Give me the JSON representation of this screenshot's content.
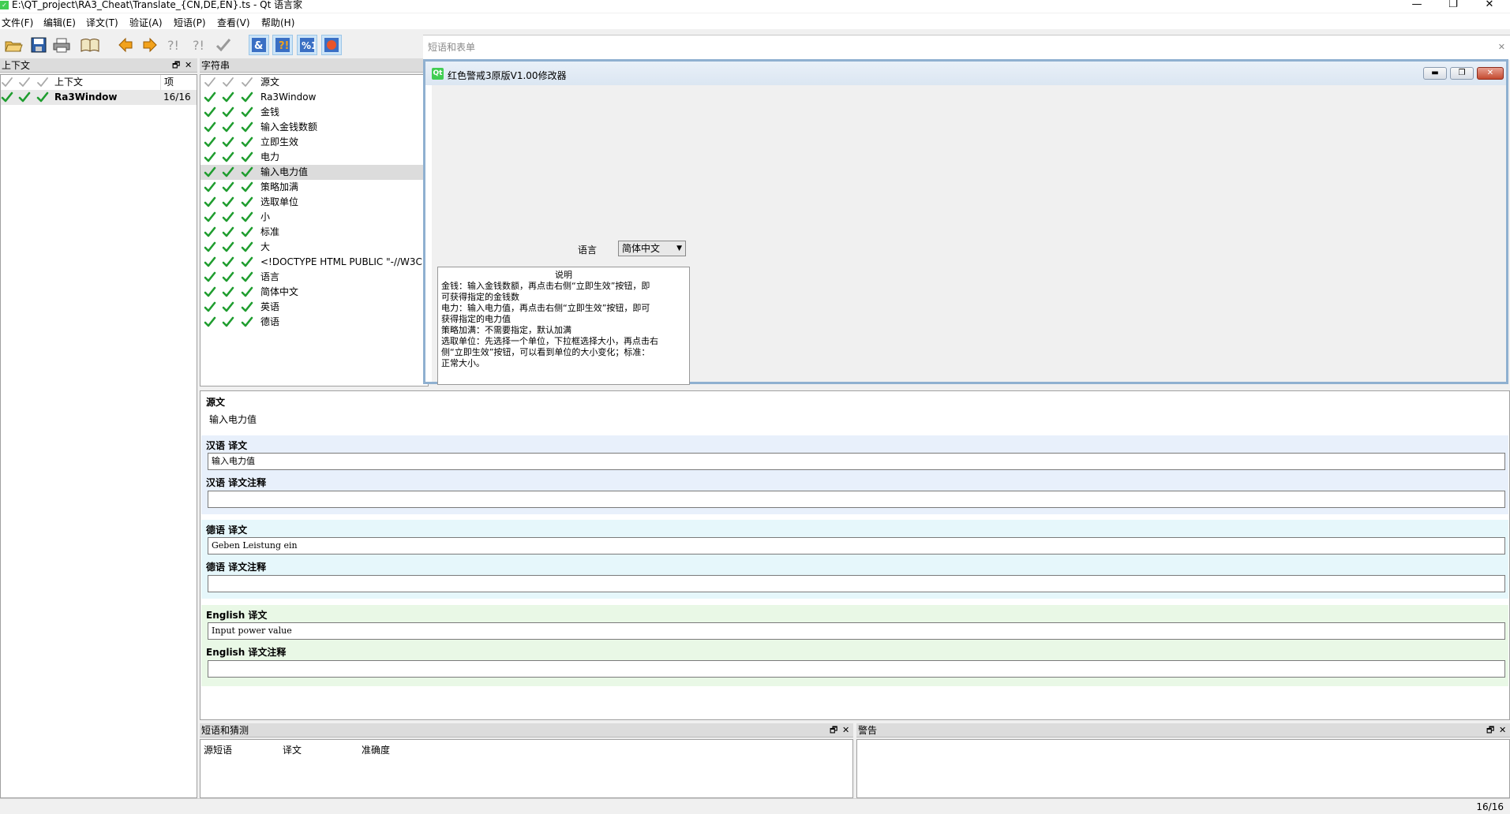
{
  "window": {
    "title": "E:\\QT_project\\RA3_Cheat\\Translate_{CN,DE,EN}.ts - Qt 语言家",
    "minimize": "—",
    "maximize": "❐",
    "close": "✕"
  },
  "menu": [
    "文件(F)",
    "编辑(E)",
    "译文(T)",
    "验证(A)",
    "短语(P)",
    "查看(V)",
    "帮助(H)"
  ],
  "toolbar_icons": [
    "open-icon",
    "save-icon",
    "print-icon",
    "phrasebook-icon",
    "previous-icon",
    "next-icon",
    "prev-unfinished-icon",
    "next-unfinished-icon",
    "done-and-next-icon",
    "accelerators-icon",
    "punctuation-icon",
    "phrase-matches-icon",
    "placemarker-icon"
  ],
  "context_pane": {
    "title": "上下文",
    "col_context": "上下文",
    "col_items": "项",
    "rows": [
      {
        "name": "Ra3Window",
        "count": "16/16"
      }
    ]
  },
  "strings_pane": {
    "title": "字符串",
    "col_source": "源文",
    "rows": [
      "Ra3Window",
      "金钱",
      "输入金钱数额",
      "立即生效",
      "电力",
      "输入电力值",
      "策略加满",
      "选取单位",
      "小",
      "标准",
      "大",
      "<!DOCTYPE HTML PUBLIC \"-//W3C",
      "语言",
      "简体中文",
      "英语",
      "德语"
    ],
    "selected_index": 5
  },
  "phrase_window": {
    "title": "短语和表单"
  },
  "preview": {
    "title": "红色警戒3原版V1.00修改器",
    "qt_logo": "Qt",
    "language_label": "语言",
    "language_value": "简体中文",
    "desc_title": "说明",
    "desc_lines": [
      "金钱：输入金钱数额，再点击右侧“立即生效”按钮，即",
      "可获得指定的金钱数",
      "电力：输入电力值，再点击右侧“立即生效”按钮，即可",
      "获得指定的电力值",
      "策略加满：不需要指定，默认加满",
      "选取单位：先选择一个单位，下拉框选择大小，再点击右",
      "侧“立即生效”按钮，可以看到单位的大小变化；标准：",
      "正常大小。"
    ]
  },
  "editor": {
    "source_label": "源文",
    "source_text": "输入电力值",
    "zh_label": "汉语 译文",
    "zh_value": "输入电力值",
    "zh_comment_label": "汉语 译文注释",
    "zh_comment_value": "",
    "de_label": "德语 译文",
    "de_value": "Geben Leistung ein",
    "de_comment_label": "德语 译文注释",
    "de_comment_value": "",
    "en_label": "English 译文",
    "en_value": "Input power value",
    "en_comment_label": "English 译文注释",
    "en_comment_value": ""
  },
  "phrases_pane": {
    "title": "短语和猜测",
    "col_source": "源短语",
    "col_translation": "译文",
    "col_accuracy": "准确度"
  },
  "warnings_pane": {
    "title": "警告"
  },
  "dock_float": "🗗",
  "dock_close": "✕",
  "status": {
    "progress": "16/16"
  },
  "colors": {
    "check_green": "#1f9d2f",
    "check_gray": "#a8a8a8",
    "zh_bg": "#e8f0fb",
    "de_bg": "#e6f7fb",
    "en_bg": "#e9f8e6"
  }
}
